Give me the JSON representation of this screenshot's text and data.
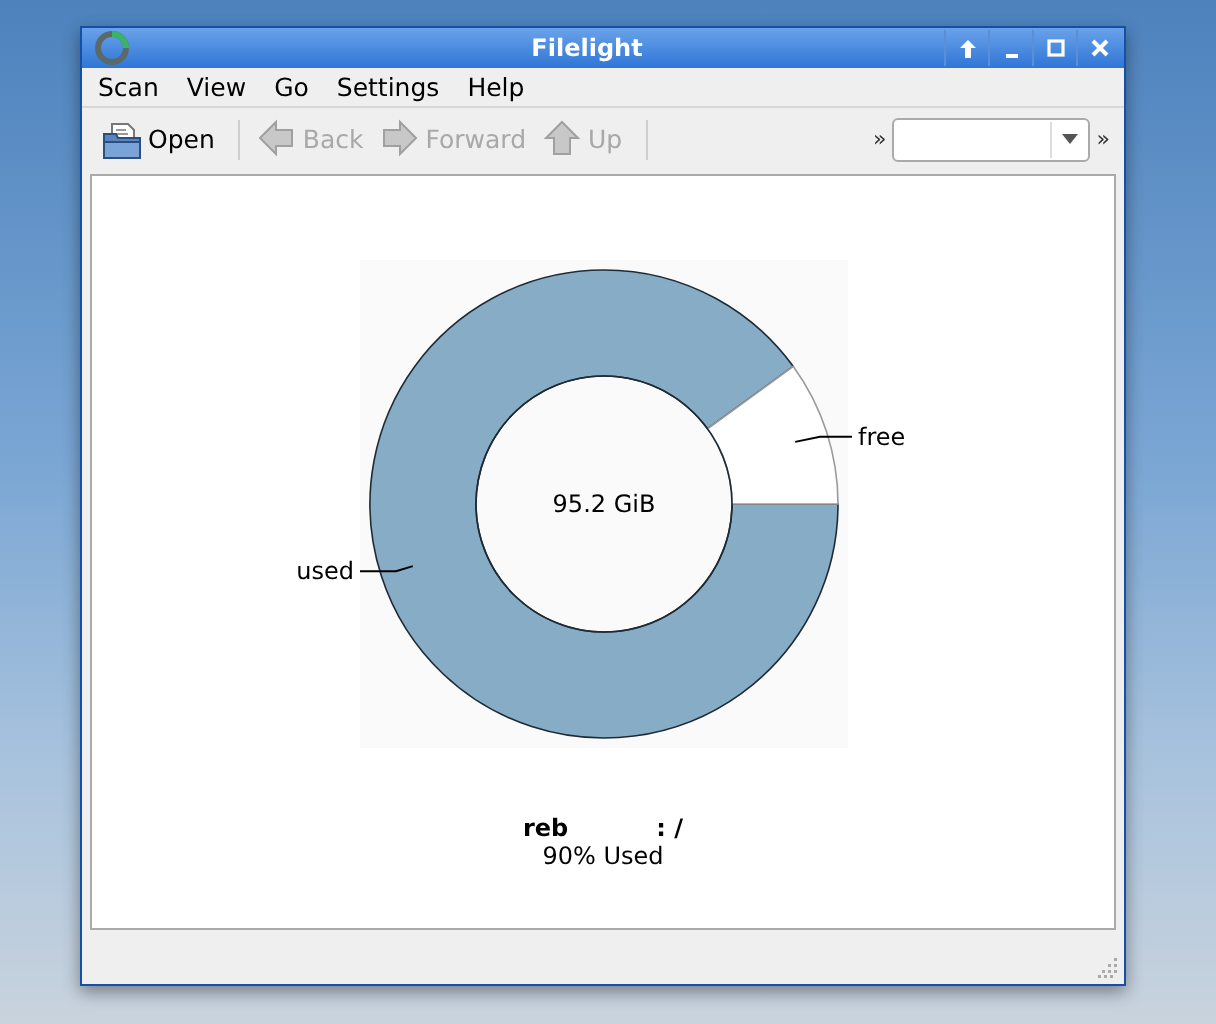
{
  "window": {
    "title": "Filelight"
  },
  "menu": [
    {
      "label": "Scan"
    },
    {
      "label": "View"
    },
    {
      "label": "Go"
    },
    {
      "label": "Settings"
    },
    {
      "label": "Help"
    }
  ],
  "toolbar": [
    {
      "kind": "open",
      "label": "Open",
      "disabled": false
    },
    {
      "kind": "back",
      "label": "Back",
      "disabled": true
    },
    {
      "kind": "forward",
      "label": "Forward",
      "disabled": true
    },
    {
      "kind": "up",
      "label": "Up",
      "disabled": true
    }
  ],
  "toolbar_extension": [
    "»",
    "»"
  ],
  "disk": {
    "chart_data": {
      "type": "donut",
      "categories": [
        "used",
        "free"
      ],
      "values": [
        90,
        10
      ]
    },
    "center_label": "95.2 GiB",
    "name": "reb",
    "mount": ": /",
    "usage": "90% Used"
  }
}
